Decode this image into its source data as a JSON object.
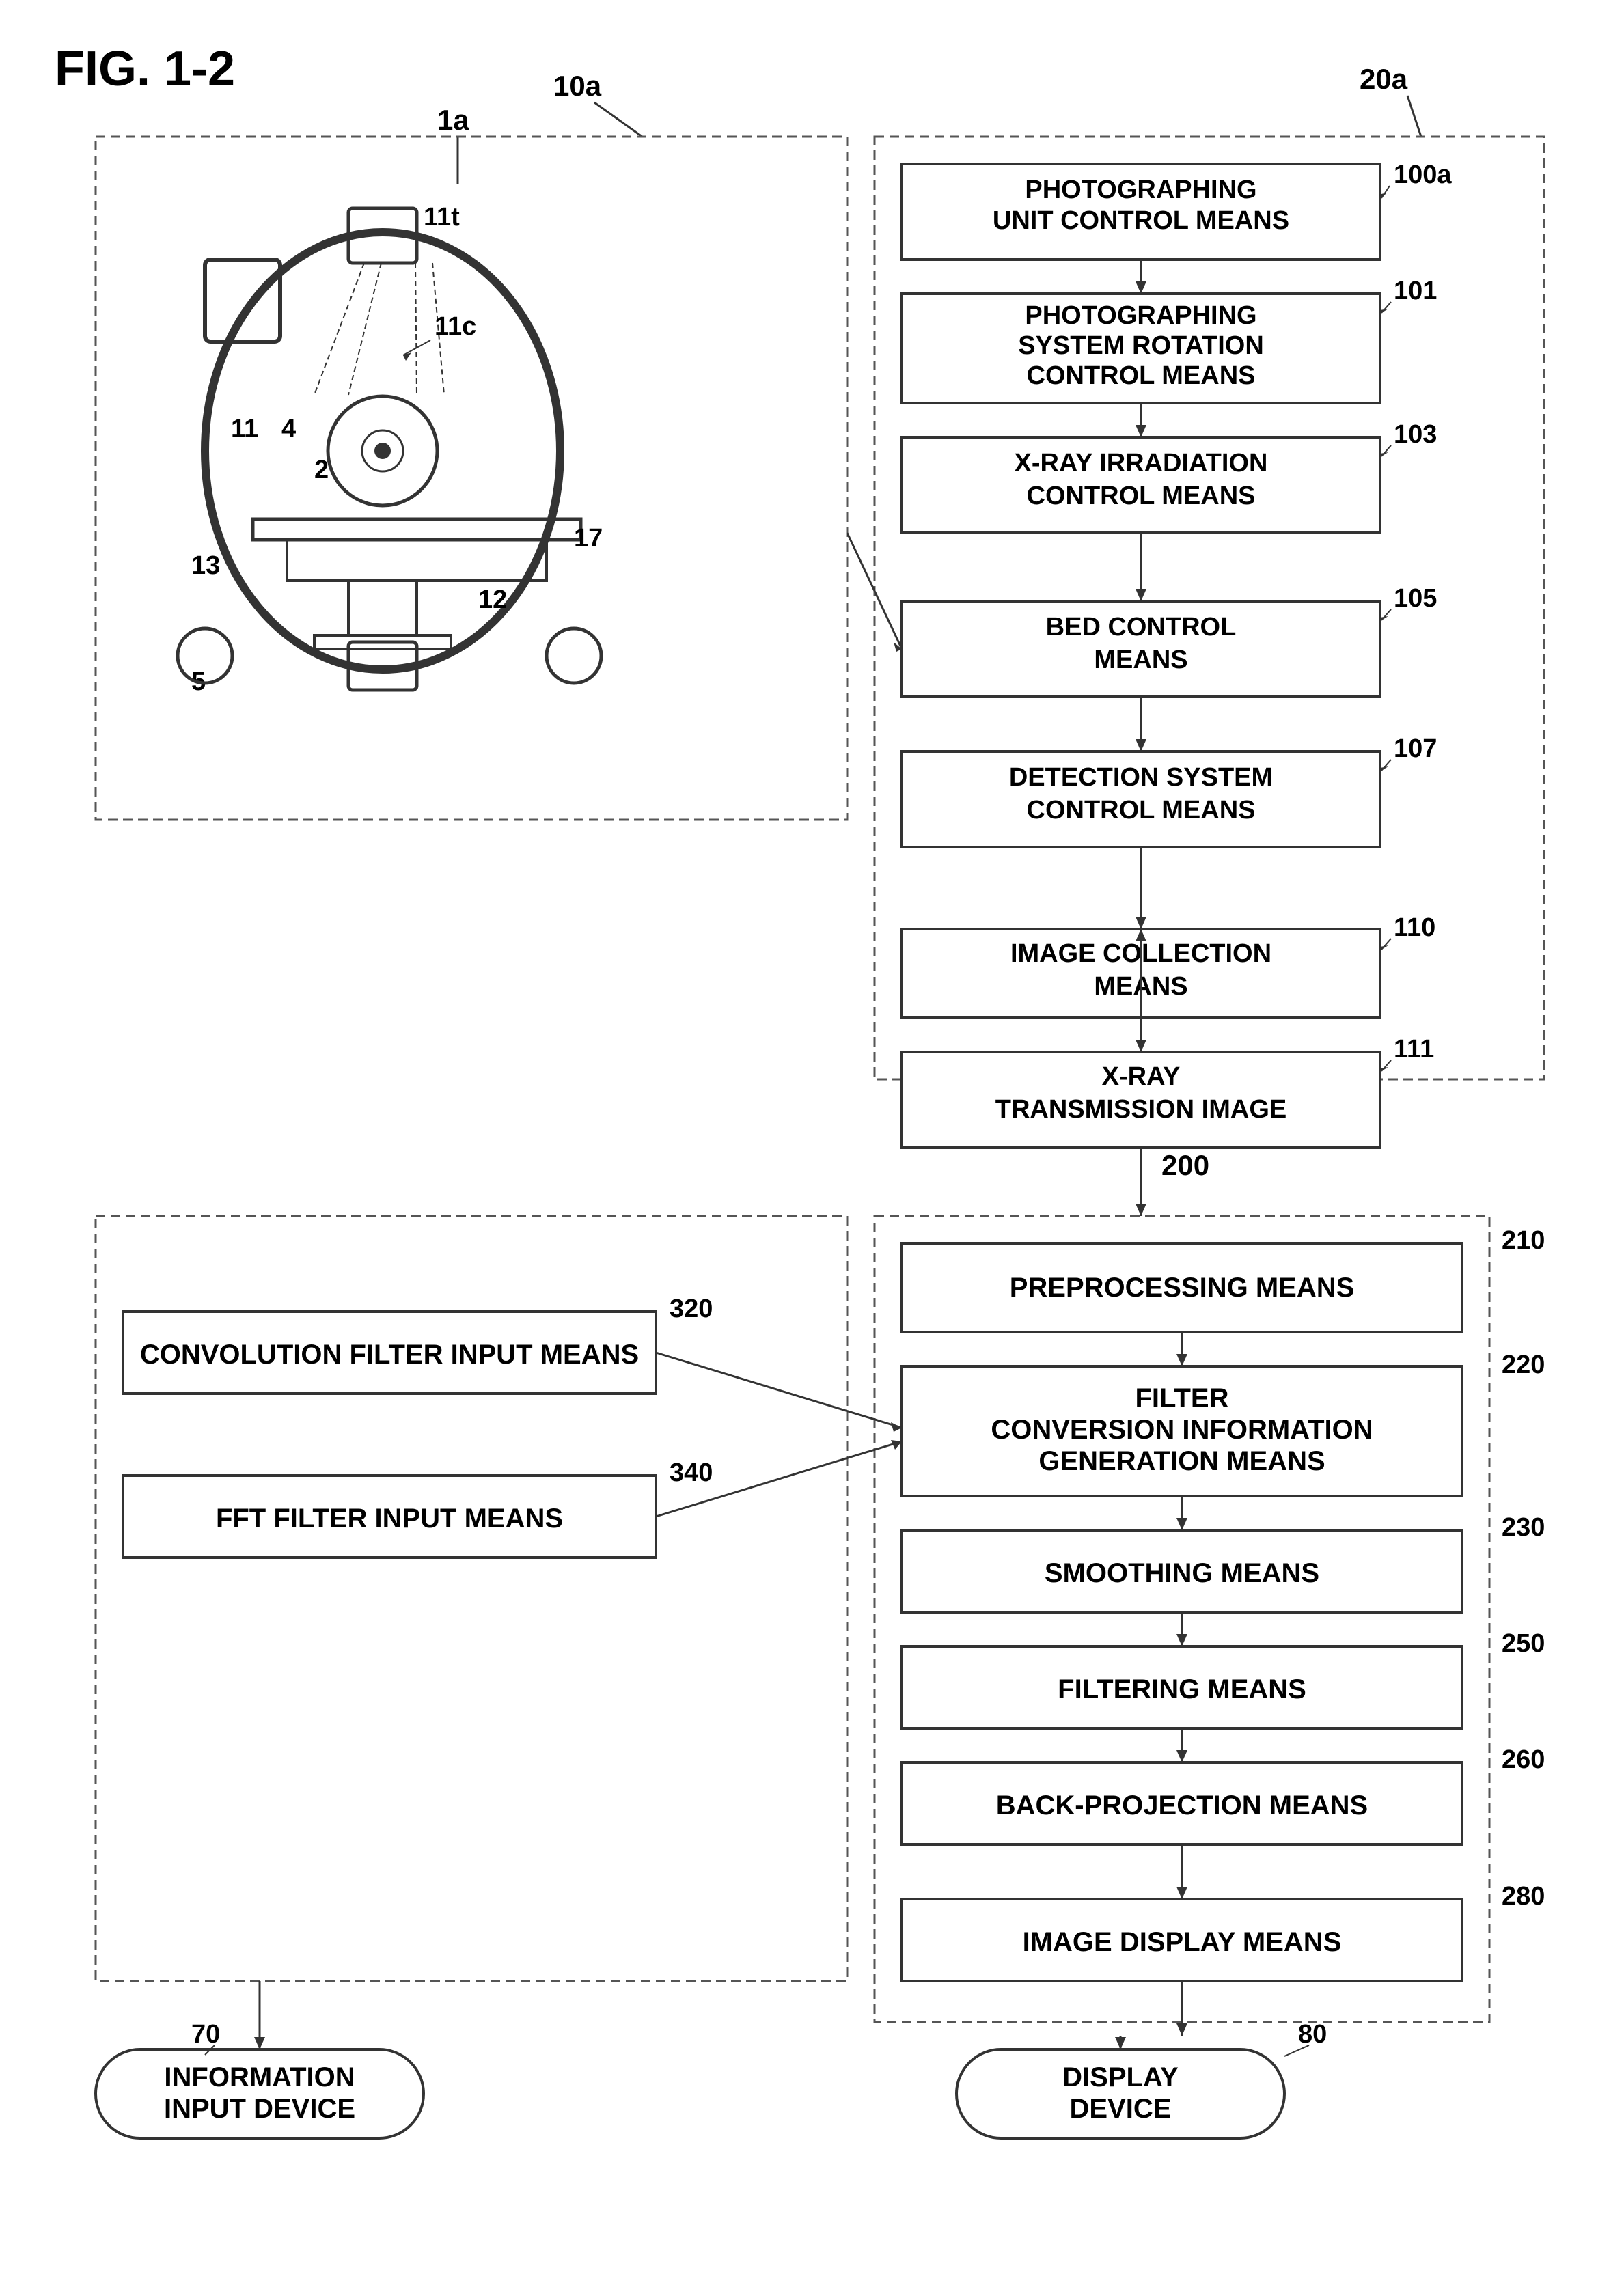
{
  "figure": {
    "title": "FIG. 1-2"
  },
  "labels": {
    "ref_1a": "1a",
    "ref_10a": "10a",
    "ref_20a": "20a",
    "ref_100a": "100a",
    "ref_101": "101",
    "ref_103": "103",
    "ref_105": "105",
    "ref_107": "107",
    "ref_110": "110",
    "ref_111": "111",
    "ref_200": "200",
    "ref_210": "210",
    "ref_220": "220",
    "ref_230": "230",
    "ref_250": "250",
    "ref_260": "260",
    "ref_280": "280",
    "ref_320": "320",
    "ref_340": "340",
    "ref_70": "70",
    "ref_80": "80",
    "ref_11t": "11t",
    "ref_11c": "11c",
    "ref_11": "11",
    "ref_2": "2",
    "ref_4": "4",
    "ref_5": "5",
    "ref_12": "12",
    "ref_13": "13",
    "ref_17": "17"
  },
  "blocks": {
    "photographing_unit_control": "PHOTOGRAPHING\nUNIT CONTROL MEANS",
    "photographing_system_rotation": "PHOTOGRAPHING\nSYSTEM ROTATION\nCONTROL MEANS",
    "xray_irradiation": "X-RAY IRRADIATION\nCONTROL MEANS",
    "bed_control": "BED CONTROL\nMEANS",
    "detection_system": "DETECTION SYSTEM\nCONTROL MEANS",
    "image_collection": "IMAGE COLLECTION\nMEANS",
    "xray_transmission": "X-RAY\nTRANSMISSION IMAGE",
    "preprocessing": "PREPROCESSING MEANS",
    "filter_conversion": "FILTER\nCONVERSION INFORMATION\nGENERATION MEANS",
    "smoothing": "SMOOTHING MEANS",
    "filtering": "FILTERING MEANS",
    "back_projection": "BACK-PROJECTION MEANS",
    "image_display": "IMAGE DISPLAY MEANS",
    "convolution_filter": "CONVOLUTION FILTER INPUT MEANS",
    "fft_filter": "FFT FILTER INPUT MEANS",
    "information_input": "INFORMATION\nINPUT DEVICE",
    "display_device": "DISPLAY\nDEVICE"
  }
}
